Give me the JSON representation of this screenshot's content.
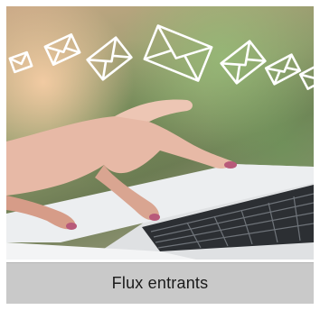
{
  "tile": {
    "caption": "Flux entrants",
    "icon": "envelope-icon"
  },
  "colors": {
    "caption_bg": "#c9c9c9",
    "caption_text": "#1a1a1a",
    "envelope_stroke": "#ffffff"
  }
}
